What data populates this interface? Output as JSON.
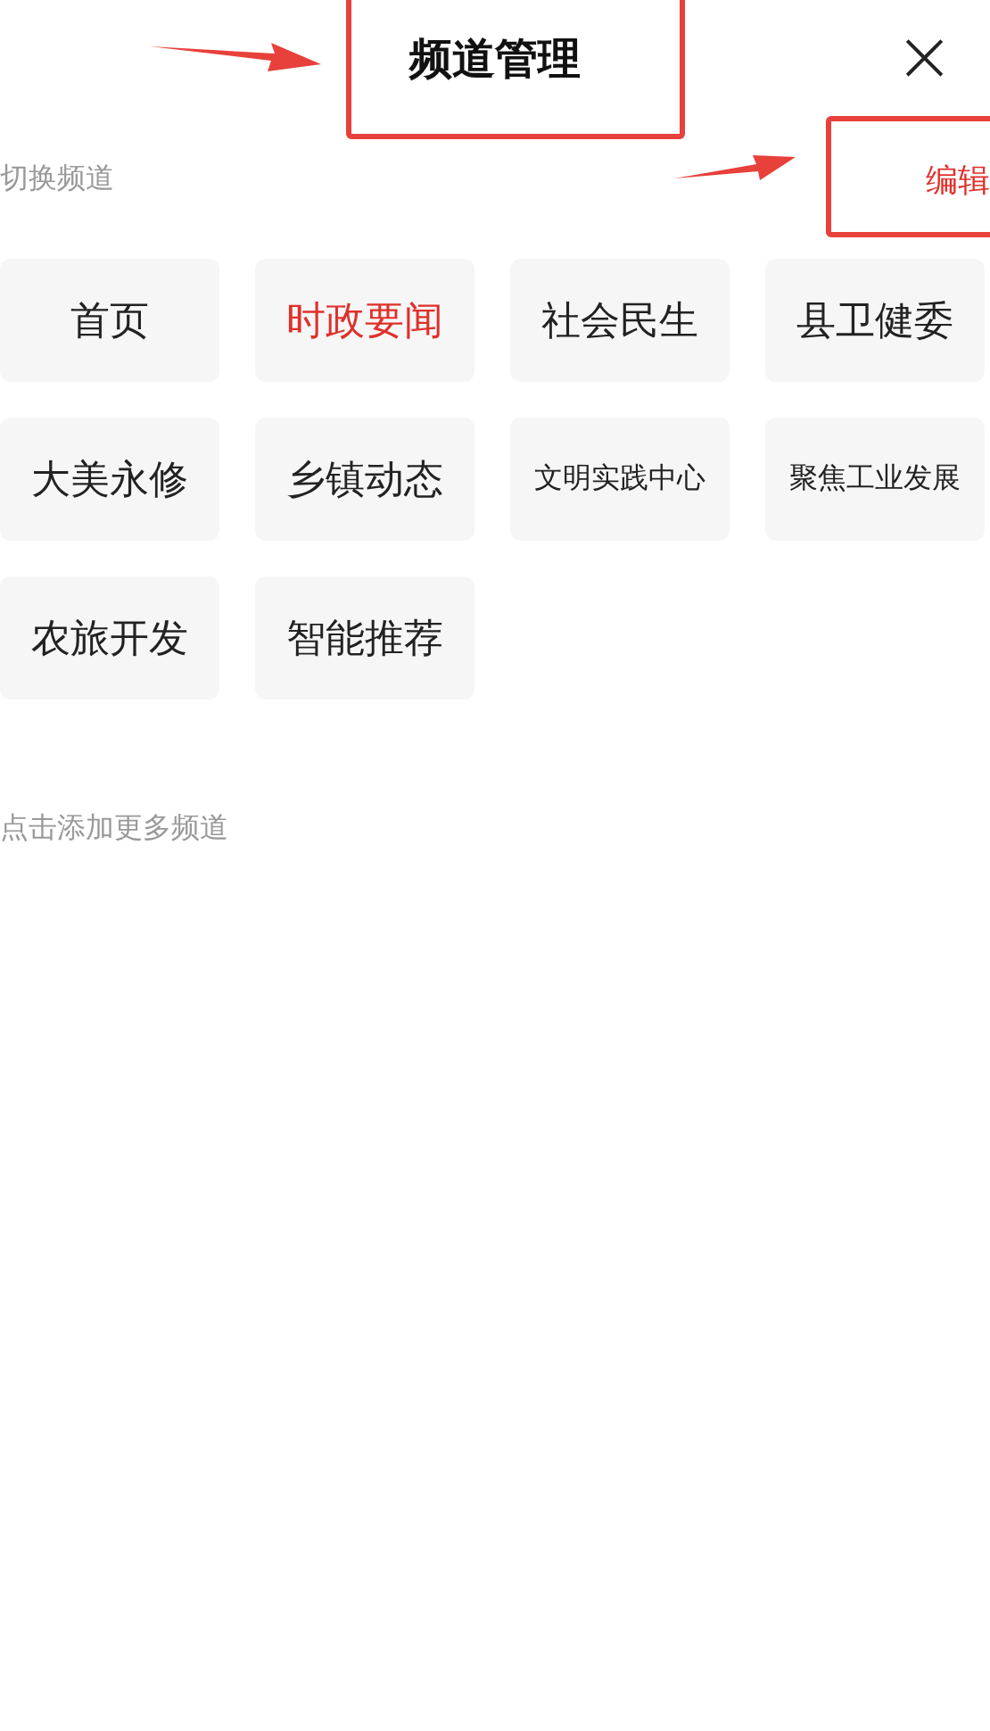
{
  "header": {
    "title": "频道管理",
    "close": "×"
  },
  "section": {
    "label": "切换频道",
    "action": "编辑"
  },
  "channels": [
    {
      "label": "首页",
      "selected": false,
      "kind": "normal"
    },
    {
      "label": "时政要闻",
      "selected": true,
      "kind": "normal"
    },
    {
      "label": "社会民生",
      "selected": false,
      "kind": "normal"
    },
    {
      "label": "县卫健委",
      "selected": false,
      "kind": "normal"
    },
    {
      "label": "大美永修",
      "selected": false,
      "kind": "normal"
    },
    {
      "label": "乡镇动态",
      "selected": false,
      "kind": "normal"
    },
    {
      "label": "文明实践中心",
      "selected": false,
      "kind": "long"
    },
    {
      "label": "聚焦工业发展",
      "selected": false,
      "kind": "long"
    },
    {
      "label": "农旅开发",
      "selected": false,
      "kind": "normal"
    },
    {
      "label": "智能推荐",
      "selected": false,
      "kind": "normal"
    }
  ],
  "more": {
    "hint": "点击添加更多频道"
  }
}
